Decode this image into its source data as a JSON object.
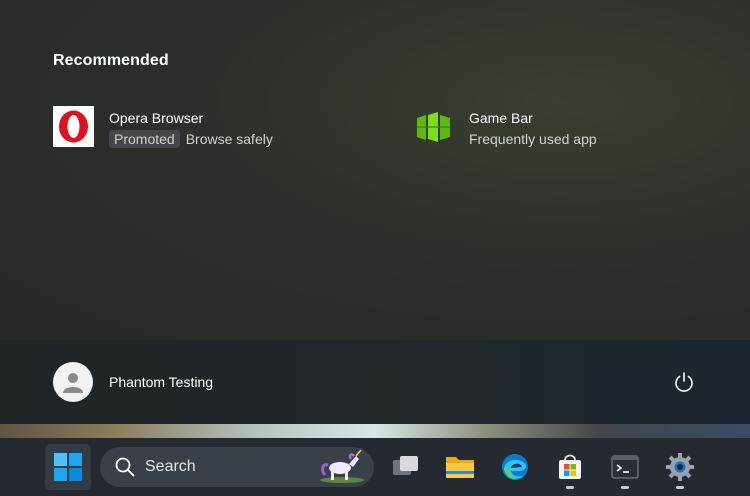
{
  "start_menu": {
    "recommended_title": "Recommended",
    "items": [
      {
        "name": "Opera Browser",
        "badge": "Promoted",
        "subtitle": "Browse safely",
        "icon": "opera-icon"
      },
      {
        "name": "Game Bar",
        "subtitle": "Frequently used app",
        "icon": "game-bar-icon"
      }
    ],
    "user": {
      "name": "Phantom Testing",
      "icon": "avatar-icon"
    },
    "power": {
      "icon": "power-icon"
    }
  },
  "taskbar": {
    "start_icon": "windows-start-icon",
    "search_placeholder": "Search",
    "search_icon": "search-icon",
    "apps": [
      {
        "name": "Task View",
        "icon": "task-view-icon",
        "running": false
      },
      {
        "name": "File Explorer",
        "icon": "file-explorer-icon",
        "running": false
      },
      {
        "name": "Microsoft Edge",
        "icon": "edge-icon",
        "running": false
      },
      {
        "name": "Microsoft Store",
        "icon": "store-icon",
        "running": true
      },
      {
        "name": "Terminal",
        "icon": "terminal-icon",
        "running": true
      },
      {
        "name": "Settings",
        "icon": "settings-icon",
        "running": true
      }
    ]
  },
  "colors": {
    "opera_red": "#e0101f",
    "gamebar_green": "#6fd20a",
    "accent_blue": "#2ea3f2"
  }
}
